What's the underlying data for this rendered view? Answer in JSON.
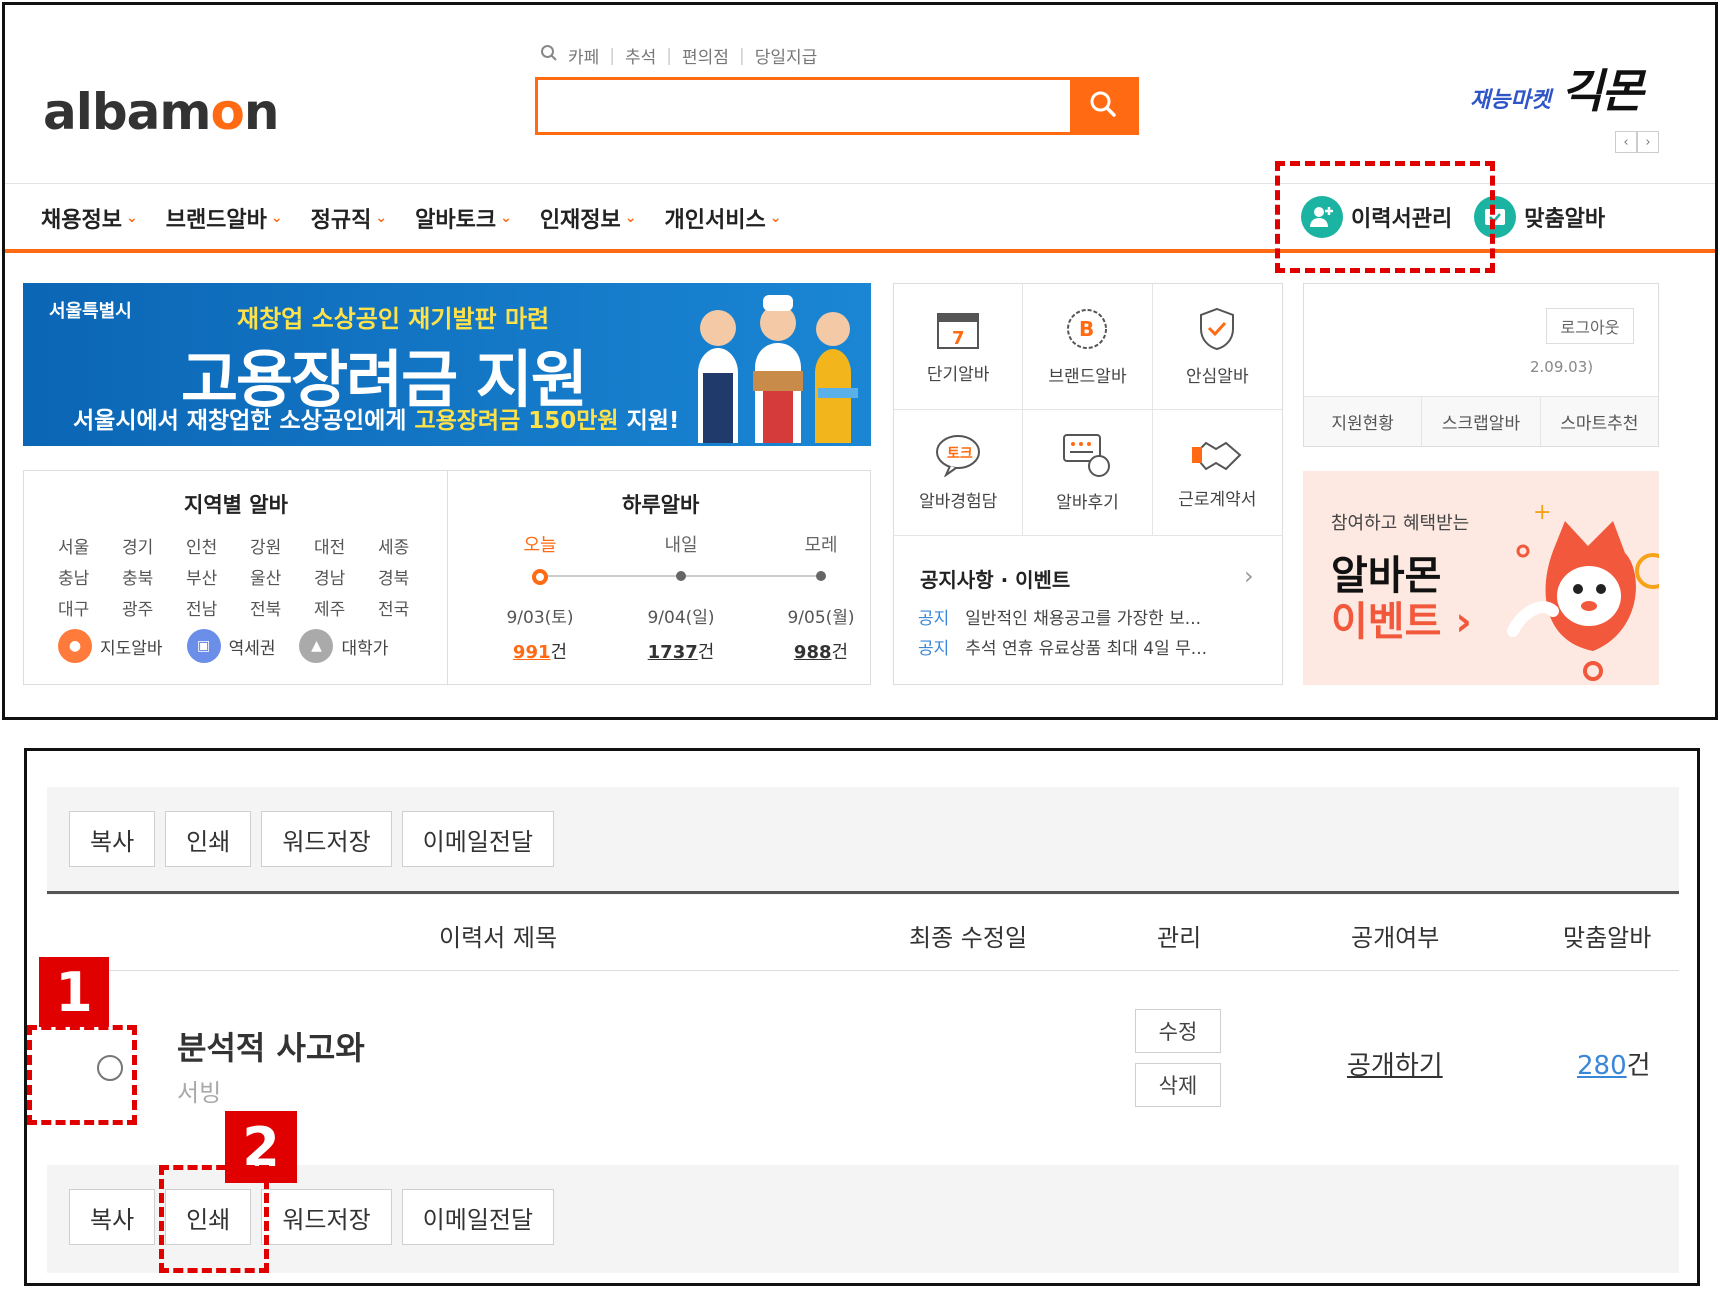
{
  "header": {
    "logo": "albamon",
    "quick_links": [
      "카페",
      "추석",
      "편의점",
      "당일지급"
    ],
    "search_placeholder": "",
    "gigmon_sub": "재능마켓",
    "gigmon_main": "긱몬"
  },
  "gnb": {
    "menu": [
      "채용정보",
      "브랜드알바",
      "정규직",
      "알바토크",
      "인재정보",
      "개인서비스"
    ],
    "resume_manage": "이력서관리",
    "custom_alba": "맞춤알바"
  },
  "banner": {
    "city": "서울특별시",
    "subtitle": "재창업 소상공인 재기발판 마련",
    "title": "고용장려금 지원",
    "desc_pre": "서울시에서 재창업한 소상공인에게 ",
    "desc_highlight": "고용장려금 150만원",
    "desc_post": " 지원!"
  },
  "region": {
    "title": "지역별 알바",
    "areas": [
      "서울",
      "경기",
      "인천",
      "강원",
      "대전",
      "세종",
      "충남",
      "충북",
      "부산",
      "울산",
      "경남",
      "경북",
      "대구",
      "광주",
      "전남",
      "전북",
      "제주",
      "전국"
    ],
    "links": [
      "지도알바",
      "역세권",
      "대학가"
    ]
  },
  "daily": {
    "title": "하루알바",
    "days": [
      {
        "label": "오늘",
        "date": "9/03(토)",
        "count": "991",
        "unit": "건"
      },
      {
        "label": "내일",
        "date": "9/04(일)",
        "count": "1737",
        "unit": "건"
      },
      {
        "label": "모레",
        "date": "9/05(월)",
        "count": "988",
        "unit": "건"
      }
    ]
  },
  "services": [
    "단기알바",
    "브랜드알바",
    "안심알바",
    "알바경험담",
    "알바후기",
    "근로계약서"
  ],
  "notice": {
    "title": "공지사항 · 이벤트",
    "items": [
      {
        "tag": "공지",
        "text": "일반적인 채용공고를 가장한 보..."
      },
      {
        "tag": "공지",
        "text": "추석 연휴 유료상품 최대 4일 무..."
      }
    ]
  },
  "login": {
    "logout": "로그아웃",
    "date": "2.09.03)",
    "tabs": [
      "지원현황",
      "스크랩알바",
      "스마트추천"
    ]
  },
  "event": {
    "small": "참여하고 혜택받는",
    "big1": "알바몬",
    "big2": "이벤트 ›"
  },
  "resume_panel": {
    "buttons": [
      "복사",
      "인쇄",
      "워드저장",
      "이메일전달"
    ],
    "headers": {
      "title": "이력서 제목",
      "modified": "최종 수정일",
      "manage": "관리",
      "public": "공개여부",
      "match": "맞춤알바"
    },
    "row": {
      "title": "분석적 사고와",
      "subtitle": "서빙",
      "edit": "수정",
      "delete": "삭제",
      "public_link": "공개하기",
      "match_count": "280",
      "match_unit": "건"
    }
  },
  "annotations": {
    "step1": "1",
    "step2": "2"
  }
}
